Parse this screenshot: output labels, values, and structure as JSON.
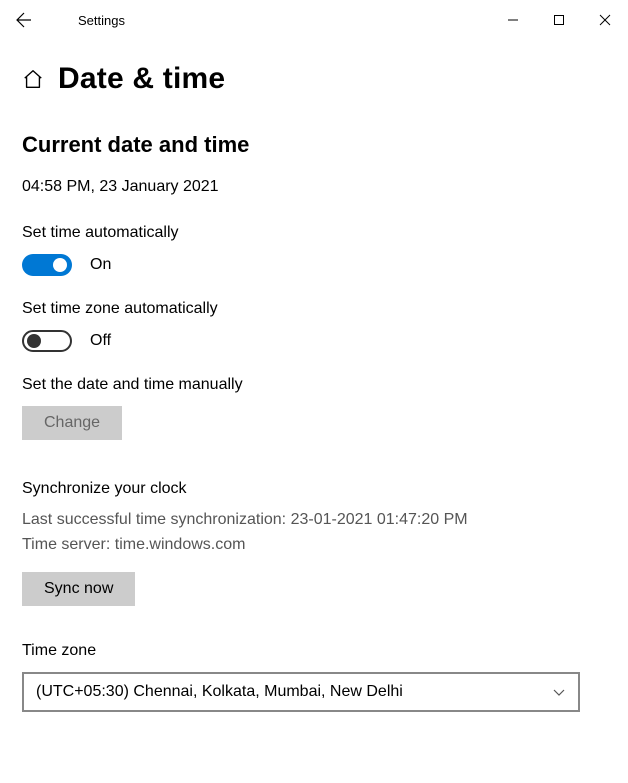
{
  "titlebar": {
    "app_title": "Settings"
  },
  "header": {
    "page_title": "Date & time"
  },
  "content": {
    "section_heading": "Current date and time",
    "current_datetime": "04:58 PM, 23 January 2021",
    "set_time_auto": {
      "label": "Set time automatically",
      "state_text": "On",
      "on": true
    },
    "set_tz_auto": {
      "label": "Set time zone automatically",
      "state_text": "Off",
      "on": false
    },
    "manual": {
      "label": "Set the date and time manually",
      "button": "Change"
    },
    "sync": {
      "heading": "Synchronize your clock",
      "last_sync": "Last successful time synchronization: 23-01-2021 01:47:20 PM",
      "server": "Time server: time.windows.com",
      "button": "Sync now"
    },
    "timezone": {
      "label": "Time zone",
      "selected": "(UTC+05:30) Chennai, Kolkata, Mumbai, New Delhi"
    }
  }
}
